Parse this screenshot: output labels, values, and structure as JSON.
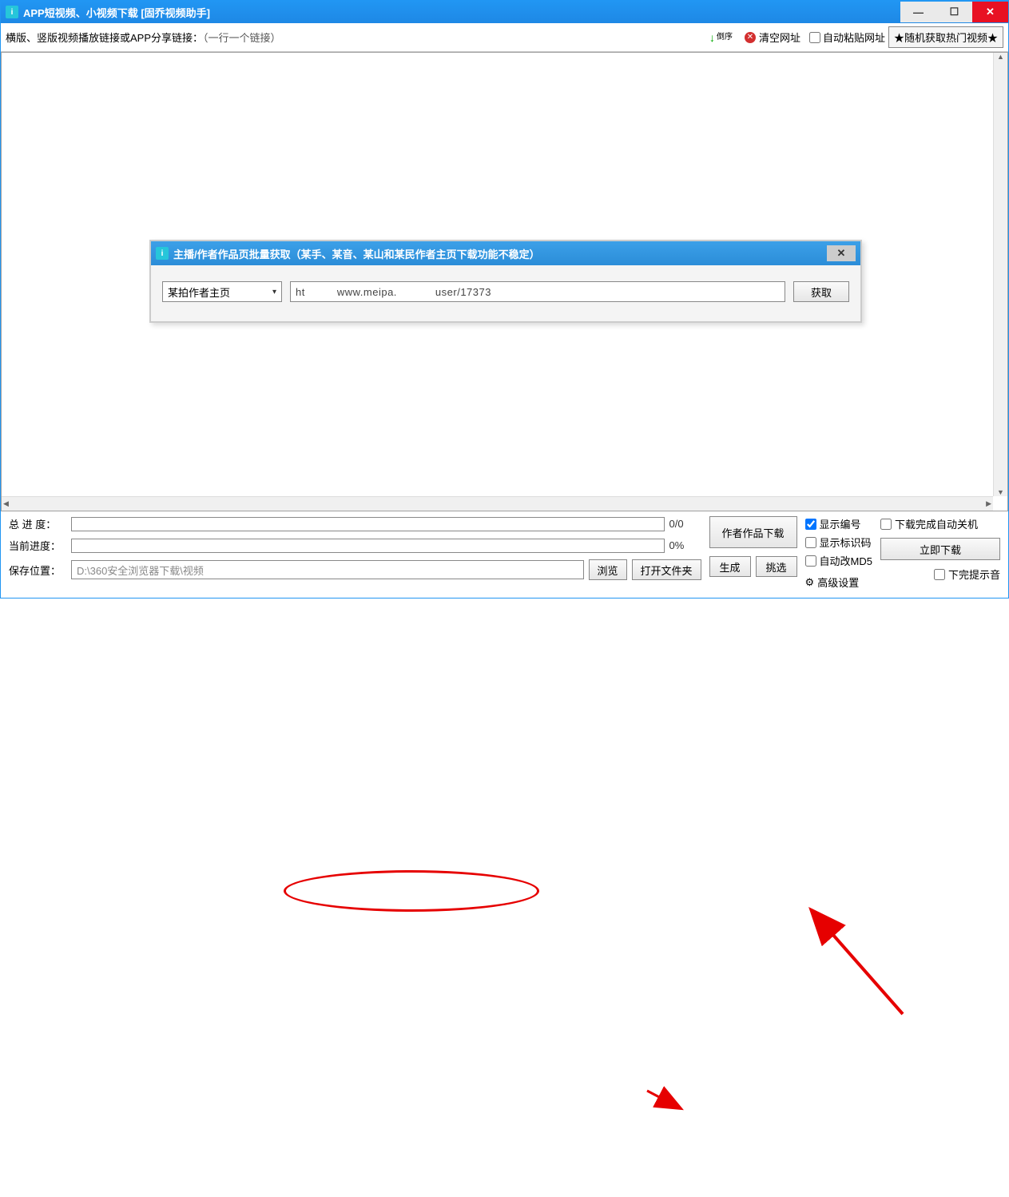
{
  "titlebar": {
    "title": "APP短视频、小视频下载 [固乔视频助手]"
  },
  "toolbar": {
    "label": "横版、竖版视频播放链接或APP分享链接：",
    "hint": "（一行一个链接）",
    "sort": "倒序",
    "clear": "清空网址",
    "autopaste": "自动粘贴网址",
    "random": "★随机获取热门视频★"
  },
  "progress": {
    "total_label": "总 进 度：",
    "total_text": "0/0",
    "current_label": "当前进度：",
    "current_text": "0%",
    "path_label": "保存位置：",
    "path_value": "D:\\360安全浏览器下载\\视频"
  },
  "buttons": {
    "browse": "浏览",
    "open_folder": "打开文件夹",
    "author_works": "作者作品下载",
    "generate": "生成",
    "pick": "挑选",
    "download_now": "立即下载"
  },
  "checks": {
    "show_index": "显示编号",
    "show_id": "显示标识码",
    "auto_md5": "自动改MD5",
    "adv": "高级设置",
    "auto_shutdown": "下载完成自动关机",
    "done_sound": "下完提示音"
  },
  "dialog": {
    "title": "主播/作者作品页批量获取（某手、某音、某山和某民作者主页下载功能不稳定）",
    "dropdown": "某拍作者主页",
    "url_pre": "ht",
    "url_mid": "www.meipa.",
    "url_post": "user/17373",
    "get": "获取"
  }
}
